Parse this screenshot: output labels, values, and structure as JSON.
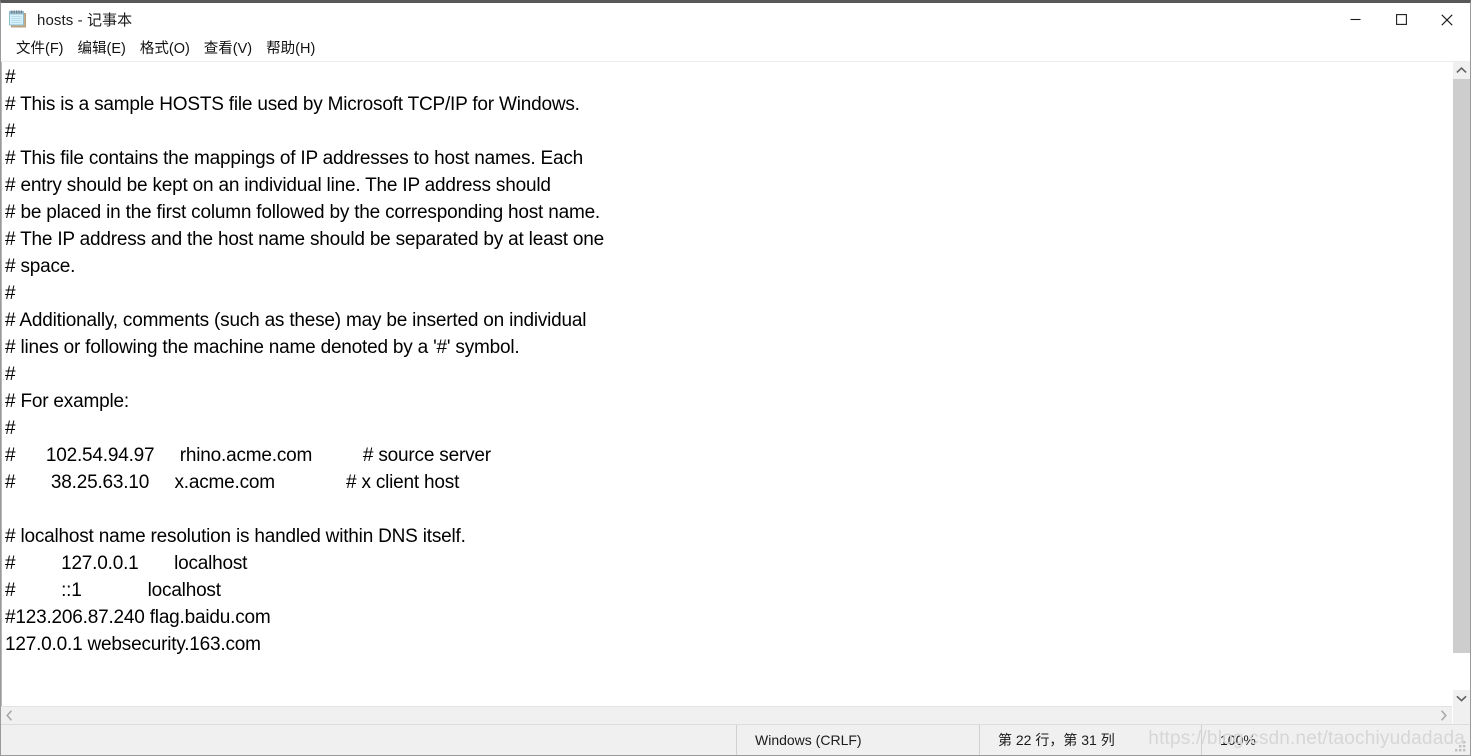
{
  "window": {
    "title": "hosts - 记事本",
    "icon": "notepad-icon",
    "controls": {
      "minimize": "最小化",
      "maximize": "最大化",
      "close": "关闭"
    }
  },
  "menubar": {
    "items": [
      {
        "label": "文件(F)",
        "name": "menu-file"
      },
      {
        "label": "编辑(E)",
        "name": "menu-edit"
      },
      {
        "label": "格式(O)",
        "name": "menu-format"
      },
      {
        "label": "查看(V)",
        "name": "menu-view"
      },
      {
        "label": "帮助(H)",
        "name": "menu-help"
      }
    ]
  },
  "editor": {
    "lines": [
      "#",
      "# This is a sample HOSTS file used by Microsoft TCP/IP for Windows.",
      "#",
      "# This file contains the mappings of IP addresses to host names. Each",
      "# entry should be kept on an individual line. The IP address should",
      "# be placed in the first column followed by the corresponding host name.",
      "# The IP address and the host name should be separated by at least one",
      "# space.",
      "#",
      "# Additionally, comments (such as these) may be inserted on individual",
      "# lines or following the machine name denoted by a '#' symbol.",
      "#",
      "# For example:",
      "#",
      "#      102.54.94.97     rhino.acme.com          # source server",
      "#       38.25.63.10     x.acme.com              # x client host",
      "",
      "# localhost name resolution is handled within DNS itself.",
      "#         127.0.0.1       localhost",
      "#         ::1             localhost",
      "#123.206.87.240 flag.baidu.com",
      "127.0.0.1 websecurity.163.com"
    ]
  },
  "scrollbars": {
    "vertical": {
      "up_arrow": "scroll-up",
      "down_arrow": "scroll-down",
      "thumb_top_pct": 0,
      "thumb_height_pct": 94
    },
    "horizontal": {
      "left_arrow": "scroll-left",
      "right_arrow": "scroll-right"
    }
  },
  "statusbar": {
    "eol": "Windows (CRLF)",
    "position": "第 22 行，第 31 列",
    "zoom": "100%"
  },
  "watermark": {
    "text": "https://blog.csdn.net/taochiyudadada"
  },
  "colors": {
    "title_border": "#585858",
    "window_bg": "#ffffff",
    "text": "#000000",
    "statusbar_bg": "#f0f0f0",
    "scrollbar_thumb": "#cdcdcd",
    "watermark": "#d6d6d6"
  }
}
